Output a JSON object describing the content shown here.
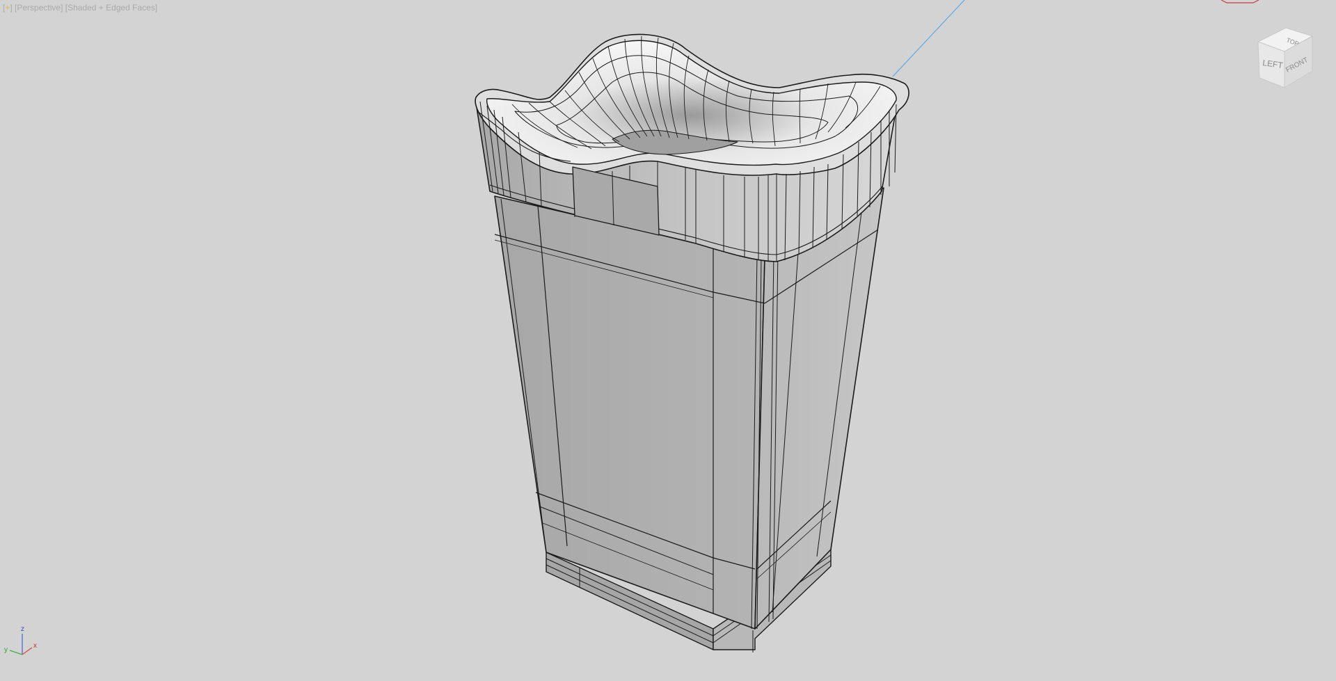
{
  "viewport": {
    "plus_label": "+",
    "view_label": "Perspective",
    "shading_label": "Shaded + Edged Faces"
  },
  "viewcube": {
    "left_face": "LEFT",
    "front_face": "FRONT",
    "top_face": "TOP"
  },
  "axis": {
    "x_label": "x",
    "y_label": "y",
    "z_label": "z"
  },
  "colors": {
    "background": "#d3d3d3",
    "axis_x": "#e04040",
    "axis_y": "#40b040",
    "axis_z": "#4060e0",
    "light_line": "#5aa8e6"
  }
}
